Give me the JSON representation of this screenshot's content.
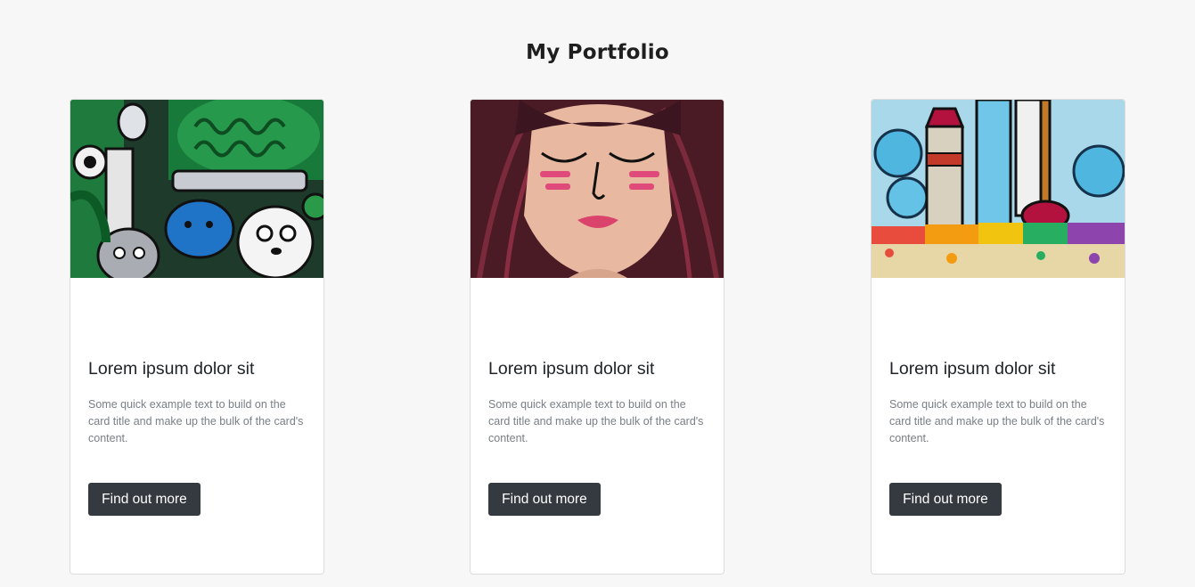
{
  "page": {
    "title": "My Portfolio"
  },
  "cards": [
    {
      "image_subject": "doodle-art-illustration",
      "title": "Lorem ipsum dolor sit",
      "text": "Some quick example text to build on the card title and make up the bulk of the card's content.",
      "button_label": "Find out more"
    },
    {
      "image_subject": "girl-portrait-illustration",
      "title": "Lorem ipsum dolor sit",
      "text": "Some quick example text to build on the card title and make up the bulk of the card's content.",
      "button_label": "Find out more"
    },
    {
      "image_subject": "art-supplies-illustration",
      "title": "Lorem ipsum dolor sit",
      "text": "Some quick example text to build on the card title and make up the bulk of the card's content.",
      "button_label": "Find out more"
    }
  ],
  "colors": {
    "background": "#f7f7f7",
    "card_background": "#ffffff",
    "button_background": "#343a40",
    "button_text": "#ffffff",
    "body_text": "#7a7f85"
  }
}
